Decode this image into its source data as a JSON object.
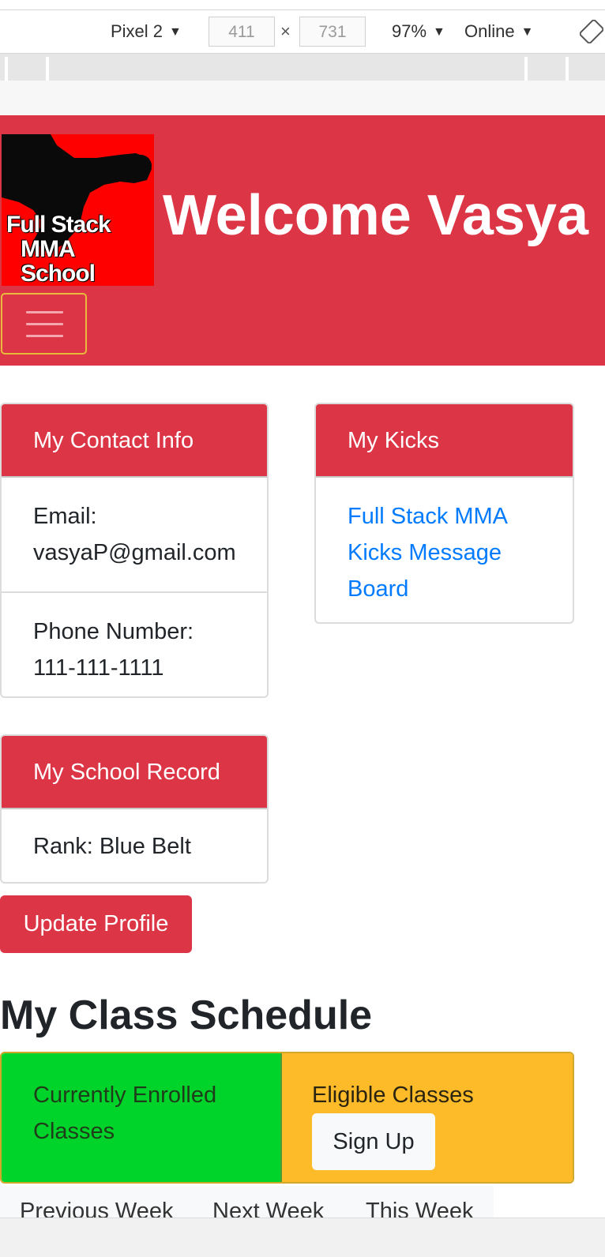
{
  "devtools": {
    "device": "Pixel 2",
    "width": "411",
    "height": "731",
    "times": "×",
    "zoom": "97%",
    "network": "Online"
  },
  "header": {
    "logo_line1": "Full Stack",
    "logo_line2": "MMA School",
    "welcome": "Welcome Vasya"
  },
  "contact_card": {
    "title": "My Contact Info",
    "email_label": "Email:",
    "email": "vasyaP@gmail.com",
    "phone_label": "Phone Number:",
    "phone": "111-111-1111"
  },
  "kicks_card": {
    "title": "My Kicks",
    "link": "Full Stack MMA Kicks Message Board"
  },
  "record_card": {
    "title": "My School Record",
    "rank": "Rank: Blue Belt"
  },
  "update_button": "Update Profile",
  "schedule": {
    "title": "My Class Schedule",
    "enrolled": "Currently Enrolled Classes",
    "eligible": "Eligible Classes",
    "signup": "Sign Up",
    "previous_week": "Previous Week",
    "next_week": "Next Week",
    "this_week": "This Week"
  },
  "colors": {
    "brand_red": "#dc3545",
    "enrolled_green": "#00d42a",
    "eligible_yellow": "#fdbb29",
    "link_blue": "#007bff"
  }
}
